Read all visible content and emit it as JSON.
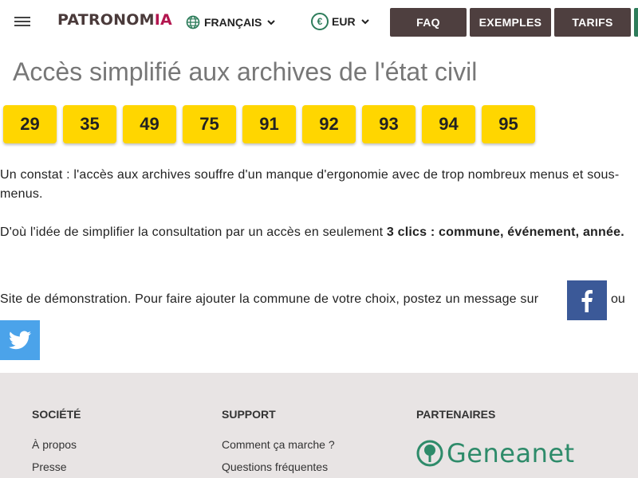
{
  "header": {
    "logo_main": "PATRONOM",
    "logo_accent": "IA",
    "language": "FRANÇAIS",
    "currency": "EUR",
    "currency_symbol": "€",
    "nav": {
      "faq": "FAQ",
      "examples": "EXEMPLES",
      "pricing": "TARIFS"
    }
  },
  "main": {
    "title": "Accès simplifié aux archives de l'état civil",
    "departments": [
      "29",
      "35",
      "49",
      "75",
      "91",
      "92",
      "93",
      "94",
      "95"
    ],
    "para1": "Un constat : l'accès aux archives souffre d'un manque d'ergonomie avec de trop nombreux menus et sous-menus.",
    "para2_start": "D'où l'idée de simplifier la consultation par un accès en seulement ",
    "para2_bold": "3 clics : commune, événement, année.",
    "para3": "Site de démonstration. Pour faire ajouter la commune de votre choix, postez un message sur",
    "para3_or": "ou"
  },
  "footer": {
    "col1": {
      "title": "SOCIÉTÉ",
      "links": [
        "À propos",
        "Presse"
      ]
    },
    "col2": {
      "title": "SUPPORT",
      "links": [
        "Comment ça marche ?",
        "Questions fréquentes"
      ]
    },
    "col3": {
      "title": "PARTENAIRES",
      "partner": "Geneanet"
    }
  },
  "colors": {
    "nav_button": "#4e3f3f",
    "accent_green": "#2e7d5b",
    "department_yellow": "#ffd600",
    "facebook": "#3b5998",
    "twitter": "#4ba3ea",
    "footer_bg": "#e8e4e4"
  },
  "icons": {
    "menu": "menu-icon",
    "language": "globe-icon",
    "facebook": "facebook-icon",
    "twitter": "twitter-icon"
  }
}
